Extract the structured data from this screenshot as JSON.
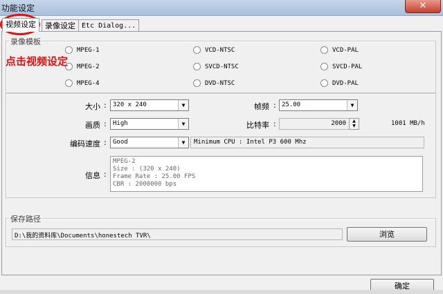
{
  "window": {
    "title": "功能设定",
    "close_glyph": "✕"
  },
  "tabs": [
    "视频设定",
    "录像设定",
    "Etc Dialog..."
  ],
  "template_group": {
    "label": "录像模板",
    "options": [
      [
        "MPEG-1",
        "VCD-NTSC",
        "VCD-PAL"
      ],
      [
        "MPEG-2",
        "SVCD-NTSC",
        "SVCD-PAL"
      ],
      [
        "MPEG-4",
        "DVD-NTSC",
        "DVD-PAL"
      ]
    ]
  },
  "annotation": "点击视频设定",
  "settings": {
    "size_label": "大小",
    "size_value": "320 x 240",
    "fps_label": "帧频",
    "fps_value": "25.00",
    "quality_label": "画质",
    "quality_value": "High",
    "bitrate_label": "比特率",
    "bitrate_value": "2000",
    "bitrate_unit": "1001 MB/h",
    "speed_label": "编码速度",
    "speed_value": "Good",
    "cpu_text": "Minimum CPU : Intel P3 600 Mhz",
    "info_label": "信息",
    "info_lines": [
      "MPEG-2",
      "Size : (320 x 240)",
      "Frame Rate : 25.00 FPS",
      "CBR : 2000000 bps"
    ],
    "colon": ":"
  },
  "save": {
    "label": "保存路径",
    "path": "D:\\我的资料库\\Documents\\honestech TVR\\",
    "browse_button": "浏览"
  },
  "ok_button": "确定",
  "colors": {
    "annotation_red": "#e01010"
  }
}
